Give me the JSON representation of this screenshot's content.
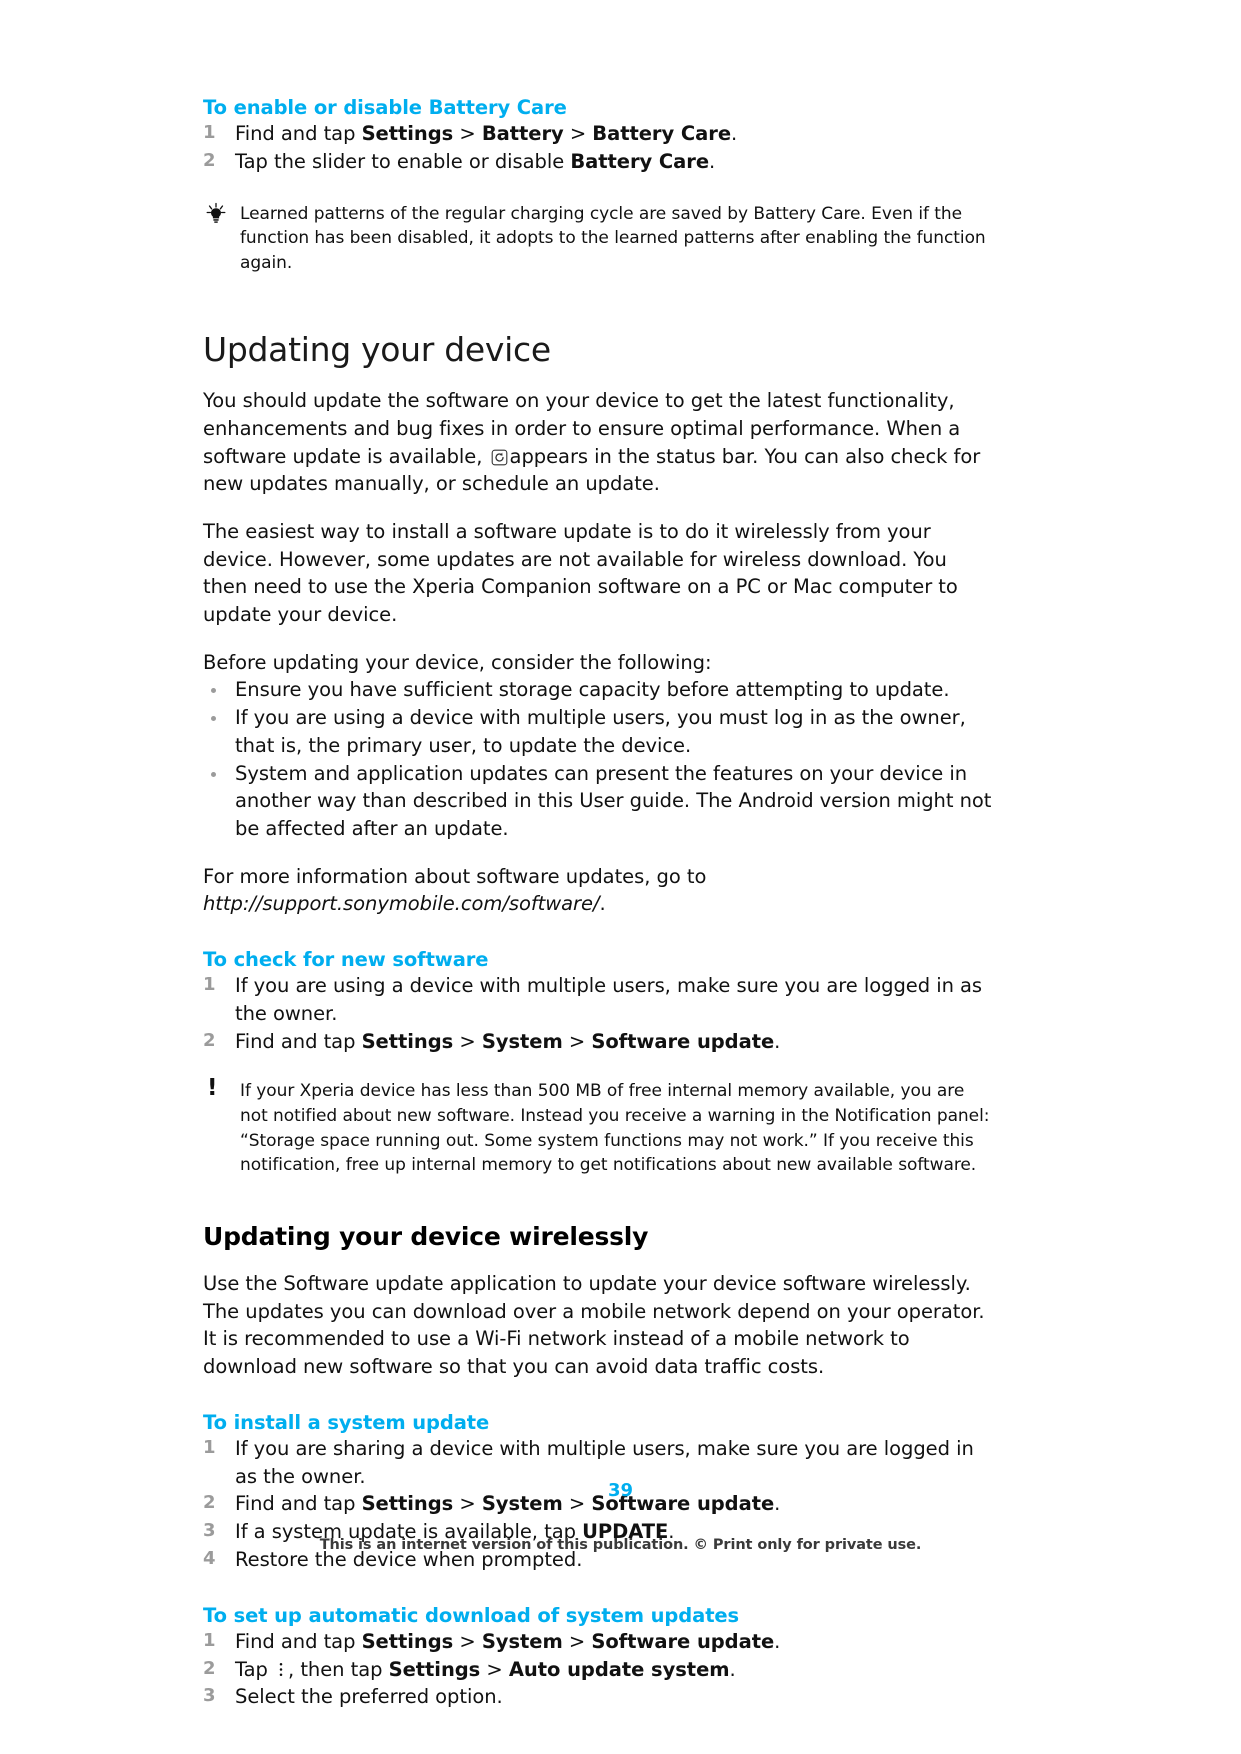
{
  "document": {
    "page_number": "39",
    "disclaimer": "This is an internet version of this publication. © Print only for private use.",
    "accent_color": "#00aeef",
    "text_color": "#111111",
    "muted_color": "#9b9b9b"
  },
  "battery_care": {
    "heading": "To enable or disable Battery Care",
    "steps": [
      {
        "num": "1",
        "prefix": "Find and tap ",
        "bold1": "Settings",
        "sep1": " > ",
        "bold2": "Battery",
        "sep2": " > ",
        "bold3": "Battery Care",
        "suffix": "."
      },
      {
        "num": "2",
        "prefix": "Tap the slider to enable or disable ",
        "bold1": "Battery Care",
        "suffix": "."
      }
    ],
    "tip_icon": "lightbulb-icon",
    "tip": "Learned patterns of the regular charging cycle are saved by Battery Care. Even if the function has been disabled, it adopts to the learned patterns after enabling the function again."
  },
  "updating": {
    "heading": "Updating your device",
    "para1_a": "You should update the software on your device to get the latest functionality, enhancements and bug fixes in order to ensure optimal performance. When a software update is available, ",
    "para1_icon": "software-update-refresh-icon",
    "para1_b": "appears in the status bar. You can also check for new updates manually, or schedule an update.",
    "para2": "The easiest way to install a software update is to do it wirelessly from your device. However, some updates are not available for wireless download. You then need to use the Xperia Companion software on a PC or Mac computer to update your device.",
    "para3": "Before updating your device, consider the following:",
    "bullets": [
      "Ensure you have sufficient storage capacity before attempting to update.",
      "If you are using a device with multiple users, you must log in as the owner, that is, the primary user, to update the device.",
      "System and application updates can present the features on your device in another way than described in this User guide. The Android version might not be affected after an update."
    ],
    "para4_prefix": "For more information about software updates, go to ",
    "para4_url": "http://support.sonymobile.com/software/",
    "para4_suffix": "."
  },
  "check_software": {
    "heading": "To check for new software",
    "steps": [
      {
        "num": "1",
        "prefix": "If you are using a device with multiple users, make sure you are logged in as the owner.",
        "suffix": ""
      },
      {
        "num": "2",
        "prefix": "Find and tap ",
        "bold1": "Settings",
        "sep1": " > ",
        "bold2": "System",
        "sep2": " > ",
        "bold3": "Software update",
        "suffix": "."
      }
    ],
    "warning_icon": "exclamation-icon",
    "warning": "If your Xperia device has less than 500 MB of free internal memory available, you are not notified about new software. Instead you receive a warning in the Notification panel: “Storage space running out. Some system functions may not work.” If you receive this notification, free up internal memory to get notifications about new available software."
  },
  "wireless": {
    "heading": "Updating your device wirelessly",
    "para": "Use the Software update application to update your device software wirelessly. The updates you can download over a mobile network depend on your operator. It is recommended to use a Wi-Fi network instead of a mobile network to download new software so that you can avoid data traffic costs."
  },
  "install_update": {
    "heading": "To install a system update",
    "steps": [
      {
        "num": "1",
        "prefix": "If you are sharing a device with multiple users, make sure you are logged in as the owner.",
        "suffix": ""
      },
      {
        "num": "2",
        "prefix": "Find and tap ",
        "bold1": "Settings",
        "sep1": " > ",
        "bold2": "System",
        "sep2": " > ",
        "bold3": "Software update",
        "suffix": "."
      },
      {
        "num": "3",
        "prefix": "If a system update is available, tap ",
        "bold1": "UPDATE",
        "suffix": "."
      },
      {
        "num": "4",
        "prefix": "Restore the device when prompted.",
        "suffix": ""
      }
    ]
  },
  "auto_download": {
    "heading": "To set up automatic download of system updates",
    "steps": [
      {
        "num": "1",
        "prefix": "Find and tap ",
        "bold1": "Settings",
        "sep1": " > ",
        "bold2": "System",
        "sep2": " > ",
        "bold3": "Software update",
        "suffix": "."
      },
      {
        "num": "2",
        "prefix": "Tap ",
        "icon": "overflow-menu-dots-icon",
        "mid": ", then tap ",
        "bold1": "Settings",
        "sep1": " > ",
        "bold2": "Auto update system",
        "suffix": "."
      },
      {
        "num": "3",
        "prefix": "Select the preferred option.",
        "suffix": ""
      }
    ]
  }
}
